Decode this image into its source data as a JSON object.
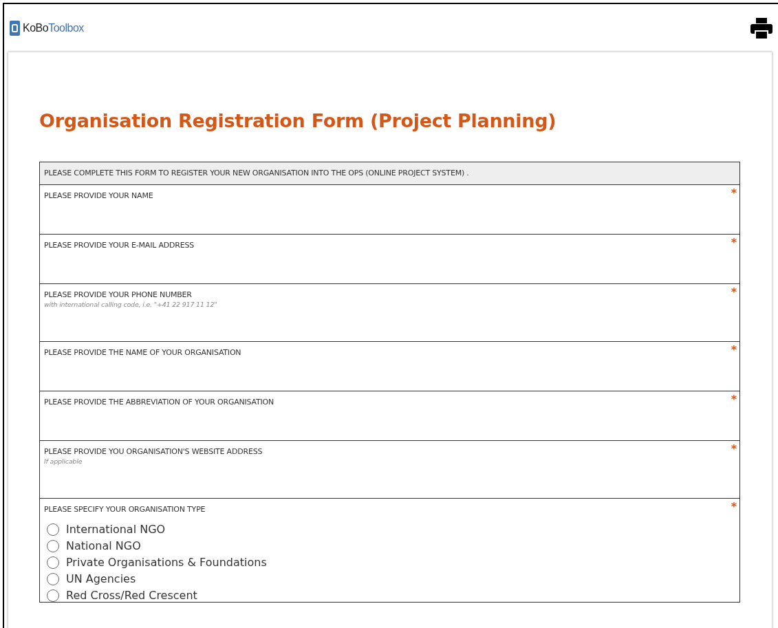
{
  "header": {
    "logo": {
      "brand": "KoBo",
      "product": "Toolbox"
    }
  },
  "form": {
    "title": "Organisation Registration Form (Project Planning)",
    "intro": "PLEASE COMPLETE THIS FORM TO REGISTER YOUR NEW ORGANISATION INTO THE OPS (ONLINE PROJECT SYSTEM) .",
    "questions": [
      {
        "kind": "text",
        "label": "PLEASE PROVIDE YOUR NAME",
        "required_mark": "*"
      },
      {
        "kind": "text",
        "label": "PLEASE PROVIDE YOUR E-MAIL ADDRESS",
        "required_mark": "*"
      },
      {
        "kind": "text",
        "label": "PLEASE PROVIDE YOUR PHONE NUMBER",
        "hint": "with international calling code, i.e. \"+41 22 917 11 12\"",
        "required_mark": "*"
      },
      {
        "kind": "text",
        "label": "PLEASE PROVIDE THE NAME OF YOUR ORGANISATION",
        "required_mark": "*"
      },
      {
        "kind": "text",
        "label": "PLEASE PROVIDE THE ABBREVIATION OF YOUR ORGANISATION",
        "required_mark": "*"
      },
      {
        "kind": "text",
        "label": "PLEASE PROVIDE YOU ORGANISATION'S WEBSITE ADDRESS",
        "hint": "If applicable",
        "required_mark": "*"
      },
      {
        "kind": "choice",
        "label": "PLEASE SPECIFY YOUR ORGANISATION TYPE",
        "required_mark": "*",
        "options": [
          {
            "label": "International NGO",
            "selected": false
          },
          {
            "label": "National NGO",
            "selected": false
          },
          {
            "label": "Private Organisations & Foundations",
            "selected": false
          },
          {
            "label": "UN Agencies",
            "selected": false
          },
          {
            "label": "Red Cross/Red Crescent",
            "selected": false
          }
        ]
      }
    ]
  }
}
